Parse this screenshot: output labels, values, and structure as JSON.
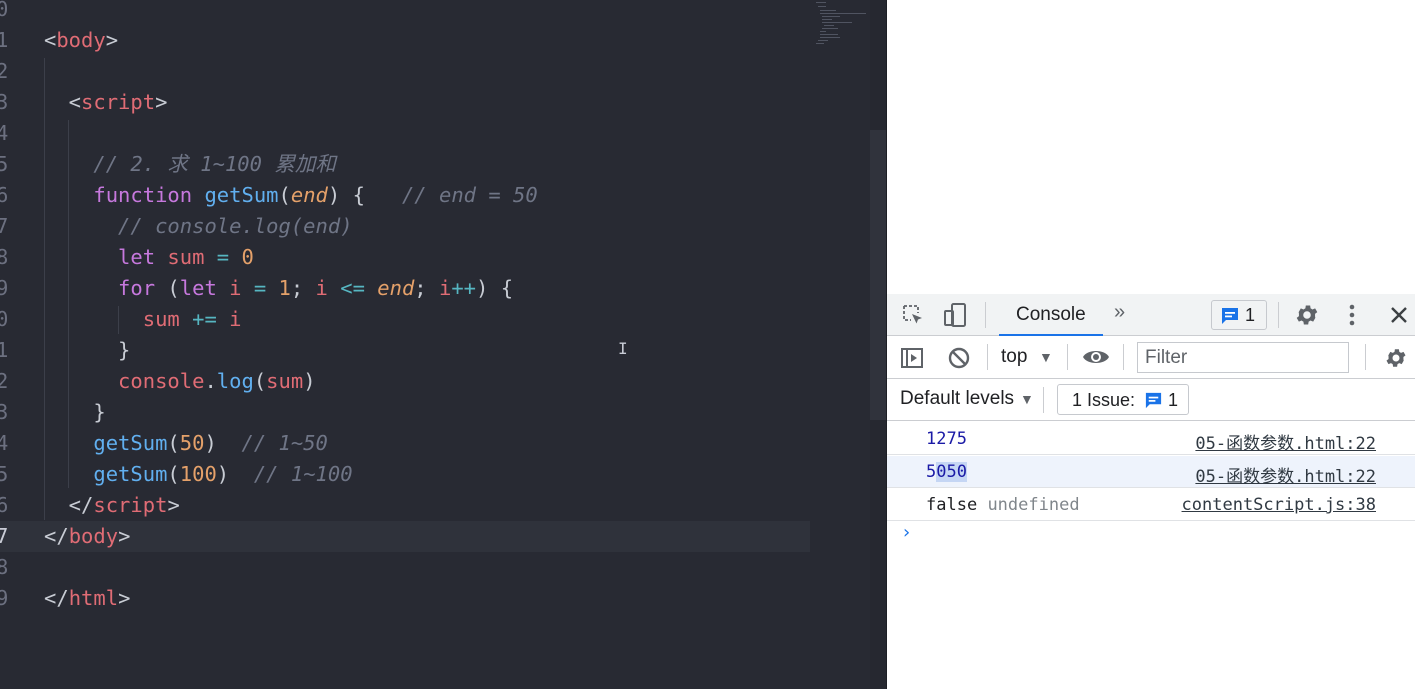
{
  "editor": {
    "lines": [
      {
        "num": "0",
        "tokens": []
      },
      {
        "num": "1",
        "tokens": [
          [
            "t-punc",
            "<"
          ],
          [
            "t-tag",
            "body"
          ],
          [
            "t-punc",
            ">"
          ]
        ]
      },
      {
        "num": "2",
        "tokens": []
      },
      {
        "num": "3",
        "tokens": [
          [
            "t-punc",
            "  <"
          ],
          [
            "t-tag",
            "script"
          ],
          [
            "t-punc",
            ">"
          ]
        ]
      },
      {
        "num": "4",
        "tokens": []
      },
      {
        "num": "5",
        "tokens": [
          [
            "t-com",
            "    // 2. 求 1~100 累加和"
          ]
        ]
      },
      {
        "num": "6",
        "tokens": [
          [
            "t-kw",
            "    function "
          ],
          [
            "t-fn",
            "getSum"
          ],
          [
            "t-punc",
            "("
          ],
          [
            "t-param",
            "end"
          ],
          [
            "t-punc",
            ") {   "
          ],
          [
            "t-com",
            "// end = 50"
          ]
        ]
      },
      {
        "num": "7",
        "tokens": [
          [
            "t-com",
            "      // console.log(end)"
          ]
        ]
      },
      {
        "num": "8",
        "tokens": [
          [
            "t-kw",
            "      let "
          ],
          [
            "t-var",
            "sum"
          ],
          [
            "t-op",
            " = "
          ],
          [
            "t-num",
            "0"
          ]
        ]
      },
      {
        "num": "9",
        "tokens": [
          [
            "t-kw",
            "      for "
          ],
          [
            "t-punc",
            "("
          ],
          [
            "t-kw",
            "let "
          ],
          [
            "t-var",
            "i"
          ],
          [
            "t-op",
            " = "
          ],
          [
            "t-num",
            "1"
          ],
          [
            "t-punc",
            "; "
          ],
          [
            "t-var",
            "i"
          ],
          [
            "t-op",
            " <= "
          ],
          [
            "t-param",
            "end"
          ],
          [
            "t-punc",
            "; "
          ],
          [
            "t-var",
            "i"
          ],
          [
            "t-op",
            "++"
          ],
          [
            "t-punc",
            ") {"
          ]
        ]
      },
      {
        "num": "0",
        "tokens": [
          [
            "t-var",
            "        sum"
          ],
          [
            "t-op",
            " += "
          ],
          [
            "t-var",
            "i"
          ]
        ]
      },
      {
        "num": "1",
        "tokens": [
          [
            "t-punc",
            "      }"
          ]
        ]
      },
      {
        "num": "2",
        "tokens": [
          [
            "t-obj",
            "      console"
          ],
          [
            "t-punc",
            "."
          ],
          [
            "t-meth",
            "log"
          ],
          [
            "t-punc",
            "("
          ],
          [
            "t-var",
            "sum"
          ],
          [
            "t-punc",
            ")"
          ]
        ]
      },
      {
        "num": "3",
        "tokens": [
          [
            "t-punc",
            "    }"
          ]
        ]
      },
      {
        "num": "4",
        "tokens": [
          [
            "t-fn",
            "    getSum"
          ],
          [
            "t-punc",
            "("
          ],
          [
            "t-num",
            "50"
          ],
          [
            "t-punc",
            ")  "
          ],
          [
            "t-com",
            "// 1~50"
          ]
        ]
      },
      {
        "num": "5",
        "tokens": [
          [
            "t-fn",
            "    getSum"
          ],
          [
            "t-punc",
            "("
          ],
          [
            "t-num",
            "100"
          ],
          [
            "t-punc",
            ")  "
          ],
          [
            "t-com",
            "// 1~100"
          ]
        ]
      },
      {
        "num": "6",
        "tokens": [
          [
            "t-punc",
            "  </"
          ],
          [
            "t-tag",
            "script"
          ],
          [
            "t-punc",
            ">"
          ]
        ]
      },
      {
        "num": "7",
        "tokens": [
          [
            "t-punc",
            "</"
          ],
          [
            "t-tag",
            "body"
          ],
          [
            "t-punc",
            ">"
          ]
        ],
        "active": true
      },
      {
        "num": "8",
        "tokens": []
      },
      {
        "num": "9",
        "tokens": [
          [
            "t-punc",
            "</"
          ],
          [
            "t-tag",
            "html"
          ],
          [
            "t-punc",
            ">"
          ]
        ]
      }
    ]
  },
  "devtools": {
    "tab_console": "Console",
    "tab_more": "»",
    "issues_count": "1",
    "context": "top",
    "filter_placeholder": "Filter",
    "levels": "Default levels",
    "issue_chip_label": "1 Issue:",
    "issue_chip_count": "1",
    "accent": "#1a73e8",
    "messages": [
      {
        "value": "1275",
        "value2": "",
        "source": "05-函数参数.html:22"
      },
      {
        "value_pre": "5",
        "value_sel": "050",
        "source": "05-函数参数.html:22"
      },
      {
        "value": "false",
        "value2": "undefined",
        "source": "contentScript.js:38"
      }
    ],
    "prompt": "›"
  }
}
